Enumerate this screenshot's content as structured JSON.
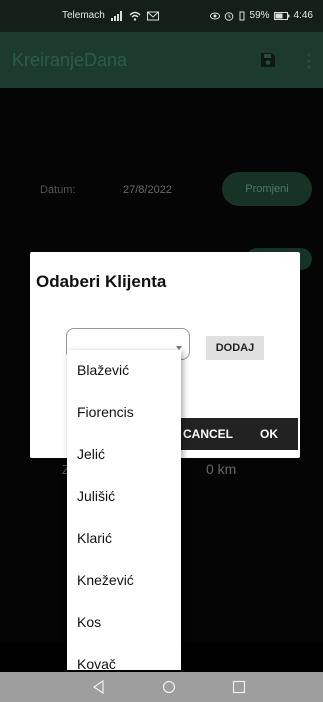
{
  "status_bar": {
    "carrier": "Telemach",
    "battery_percent": "59%",
    "time": "4:46"
  },
  "app_bar": {
    "title": "KreiranjeDana",
    "save_icon": "save-icon",
    "more_icon": "more-vert-icon"
  },
  "form": {
    "datum_label": "Datum:",
    "datum_value": "27/8/2022",
    "promjeni_label": "Promjeni",
    "zaprimljeno_label": "Z",
    "km_value": "0 km"
  },
  "dialog": {
    "title": "Odaberi Klijenta",
    "dodaj_label": "DODAJ",
    "cancel_label": "CANCEL",
    "ok_label": "OK",
    "options": [
      "Blažević",
      "Fiorencis",
      "Jelić",
      "Julišić",
      "Klarić",
      "Knežević",
      "Kos",
      "Kovač"
    ]
  },
  "colors": {
    "app_bar": "#1d3a2e",
    "status_bar": "#151f1a",
    "accent_button": "#163325",
    "nav_bar": "#9e9e9e"
  }
}
